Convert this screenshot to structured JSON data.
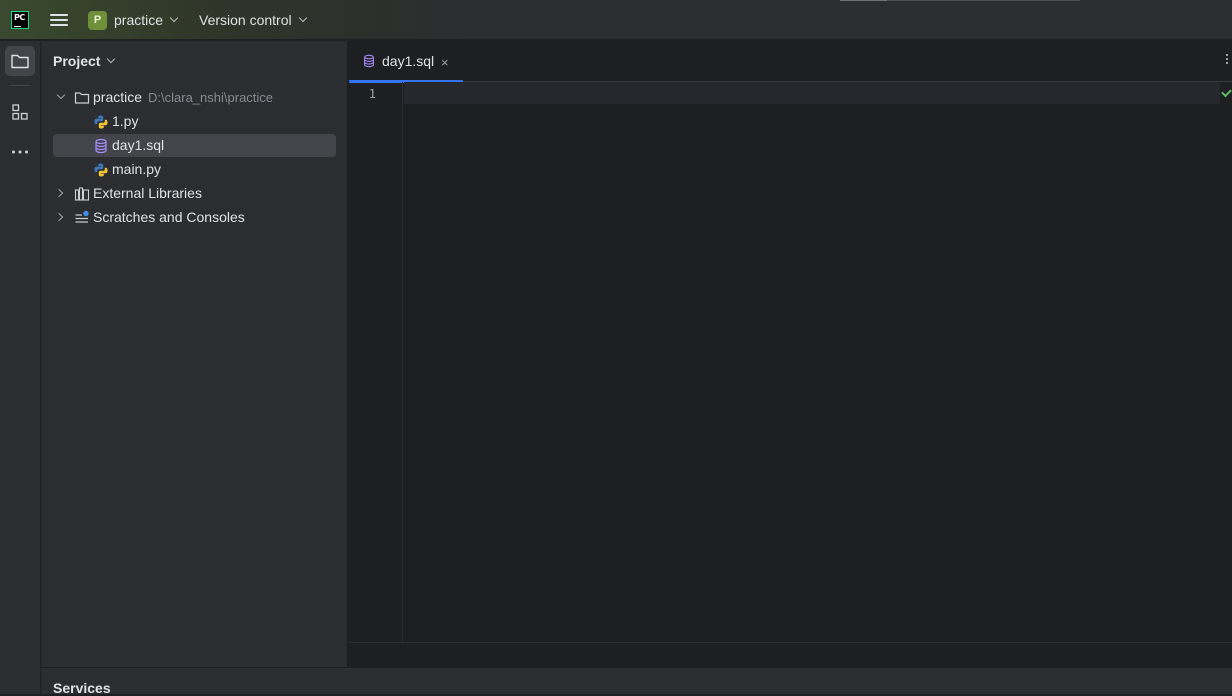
{
  "app": {
    "logo_text": "PC"
  },
  "titlebar": {
    "project_badge": "P",
    "project_name": "practice",
    "vcs_label": "Version control"
  },
  "project_panel": {
    "title": "Project",
    "tree": [
      {
        "label": "practice",
        "path": "D:\\clara_nshi\\practice",
        "type": "folder",
        "expanded": true
      },
      {
        "label": "1.py",
        "type": "python-file"
      },
      {
        "label": "day1.sql",
        "type": "sql-file",
        "selected": true
      },
      {
        "label": "main.py",
        "type": "python-file"
      },
      {
        "label": "External Libraries",
        "type": "library",
        "expanded": false
      },
      {
        "label": "Scratches and Consoles",
        "type": "scratches",
        "expanded": false
      }
    ]
  },
  "editor": {
    "tabs": [
      {
        "label": "day1.sql",
        "icon": "database-icon",
        "active": true
      }
    ],
    "close_glyph": "×",
    "line_numbers": [
      "1"
    ]
  },
  "bottom_panel": {
    "title": "Services"
  },
  "colors": {
    "accent": "#3574f0",
    "python_blue": "#3d7ab8",
    "python_yellow": "#f1c232",
    "sql_purple": "#a78bfa",
    "project_badge": "#6f8f3a"
  }
}
